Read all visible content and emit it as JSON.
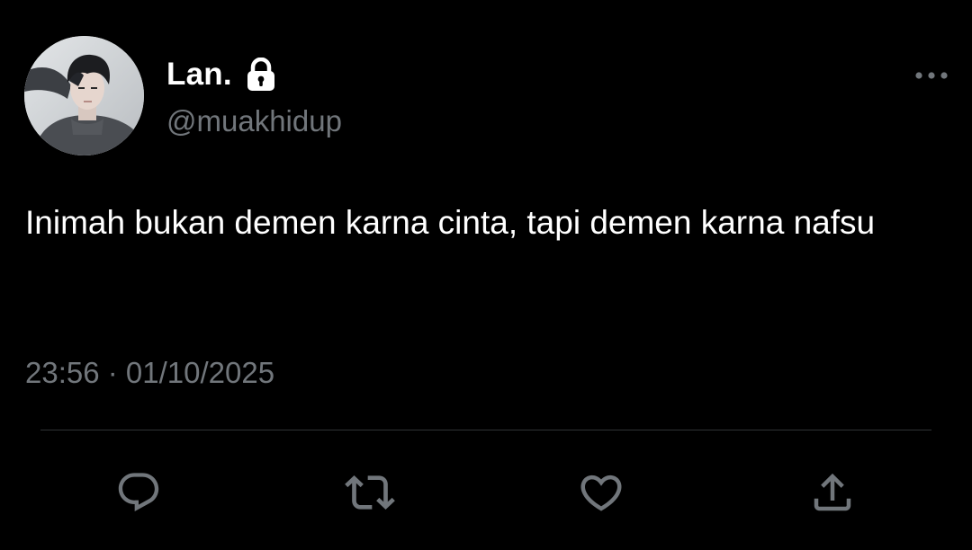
{
  "tweet": {
    "display_name": "Lan.",
    "handle": "@muakhidup",
    "text": "Inimah bukan demen karna cinta, tapi demen karna nafsu",
    "timestamp": "23:56 · 01/10/2025",
    "protected": true
  },
  "icons": {
    "lock": "lock-icon",
    "more": "more-horizontal-icon",
    "reply": "reply-icon",
    "retweet": "retweet-icon",
    "like": "heart-icon",
    "share": "share-icon"
  },
  "colors": {
    "background": "#000000",
    "text_primary": "#ffffff",
    "text_secondary": "#71767b",
    "divider": "#2f3336",
    "icon": "#71767b"
  }
}
